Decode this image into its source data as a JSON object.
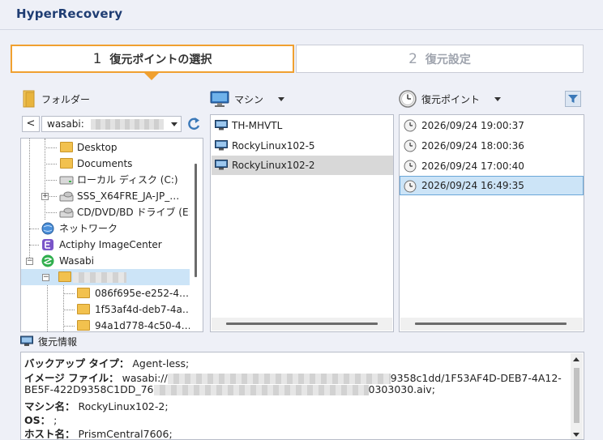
{
  "app": {
    "title": "HyperRecovery"
  },
  "steps": [
    {
      "num": "1",
      "label": "復元ポイントの選択"
    },
    {
      "num": "2",
      "label": "復元設定"
    }
  ],
  "folder_col": {
    "label": "フォルダー",
    "back_label": "<",
    "path_value": "wasabi:"
  },
  "machine_col": {
    "label": "マシン"
  },
  "points_col": {
    "label": "復元ポイント"
  },
  "tree": {
    "items": [
      {
        "label": "Desktop"
      },
      {
        "label": "Documents"
      },
      {
        "label": "ローカル ディスク (C:)"
      },
      {
        "label": "SSS_X64FRE_JA-JP_…"
      },
      {
        "label": "CD/DVD/BD ドライブ (E:)"
      },
      {
        "label": "ネットワーク"
      },
      {
        "label": "Actiphy ImageCenter"
      },
      {
        "label": "Wasabi"
      },
      {
        "label": ""
      },
      {
        "label": "086f695e-e252-4…"
      },
      {
        "label": "1f53af4d-deb7-4a…"
      },
      {
        "label": "94a1d778-4c50-4…"
      }
    ]
  },
  "machines": [
    {
      "label": "TH-MHVTL"
    },
    {
      "label": "RockyLinux102-5"
    },
    {
      "label": "RockyLinux102-2"
    }
  ],
  "points": [
    {
      "label": "2026/09/24 19:00:37"
    },
    {
      "label": "2026/09/24 18:00:36"
    },
    {
      "label": "2026/09/24 17:00:40"
    },
    {
      "label": "2026/09/24 16:49:35"
    }
  ],
  "info": {
    "header": "復元情報",
    "backup_type_key": "バックアップ タイプ：",
    "backup_type_val": "Agent-less;",
    "image_file_key": "イメージ ファイル：",
    "image_file_val_start": "wasabi://",
    "image_file_val_end": "9358c1dd/1F53AF4D-DEB7-4A12-",
    "image_file_line2": "BE5F-422D9358C1DD_76",
    "image_file_line2_end": "0303030.aiv;",
    "machine_key": "マシン名：",
    "machine_val": "RockyLinux102-2;",
    "os_key": "OS：",
    "os_val": ";",
    "host_key": "ホスト名：",
    "host_val": "PrismCentral7606;"
  },
  "colors": {
    "accent": "#f0a030",
    "title": "#1f3d73",
    "selection": "#cce4f7"
  }
}
